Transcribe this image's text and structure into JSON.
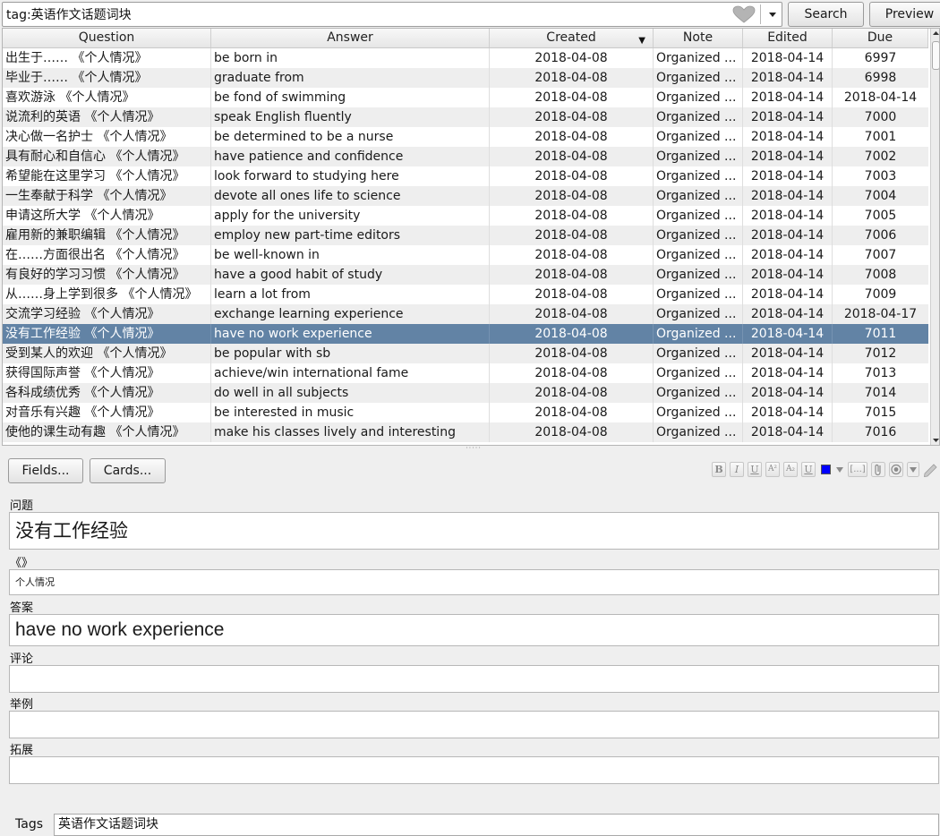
{
  "search": {
    "query": "tag:英语作文话题词块",
    "search_label": "Search",
    "preview_label": "Preview"
  },
  "table": {
    "columns": [
      "Question",
      "Answer",
      "Created",
      "Note",
      "Edited",
      "Due"
    ],
    "sorted_column": "Created",
    "rows": [
      {
        "question": "出生于…… 《个人情况》",
        "answer": "be born in",
        "created": "2018-04-08",
        "note": "Organized ...",
        "edited": "2018-04-14",
        "due": "6997"
      },
      {
        "question": "毕业于…… 《个人情况》",
        "answer": "graduate from",
        "created": "2018-04-08",
        "note": "Organized ...",
        "edited": "2018-04-14",
        "due": "6998"
      },
      {
        "question": "喜欢游泳 《个人情况》",
        "answer": "be fond of swimming",
        "created": "2018-04-08",
        "note": "Organized ...",
        "edited": "2018-04-14",
        "due": "2018-04-14"
      },
      {
        "question": "说流利的英语 《个人情况》",
        "answer": "speak English fluently",
        "created": "2018-04-08",
        "note": "Organized ...",
        "edited": "2018-04-14",
        "due": "7000"
      },
      {
        "question": "决心做一名护士 《个人情况》",
        "answer": "be determined to be a nurse",
        "created": "2018-04-08",
        "note": "Organized ...",
        "edited": "2018-04-14",
        "due": "7001"
      },
      {
        "question": "具有耐心和自信心 《个人情况》",
        "answer": "have patience and confidence",
        "created": "2018-04-08",
        "note": "Organized ...",
        "edited": "2018-04-14",
        "due": "7002"
      },
      {
        "question": "希望能在这里学习 《个人情况》",
        "answer": "look forward to studying here",
        "created": "2018-04-08",
        "note": "Organized ...",
        "edited": "2018-04-14",
        "due": "7003"
      },
      {
        "question": "一生奉献于科学 《个人情况》",
        "answer": "devote all ones life to science",
        "created": "2018-04-08",
        "note": "Organized ...",
        "edited": "2018-04-14",
        "due": "7004"
      },
      {
        "question": "申请这所大学 《个人情况》",
        "answer": "apply for the university",
        "created": "2018-04-08",
        "note": "Organized ...",
        "edited": "2018-04-14",
        "due": "7005"
      },
      {
        "question": "雇用新的兼职编辑 《个人情况》",
        "answer": "employ new part-time editors",
        "created": "2018-04-08",
        "note": "Organized ...",
        "edited": "2018-04-14",
        "due": "7006"
      },
      {
        "question": "在……方面很出名 《个人情况》",
        "answer": "be well-known in",
        "created": "2018-04-08",
        "note": "Organized ...",
        "edited": "2018-04-14",
        "due": "7007"
      },
      {
        "question": "有良好的学习习惯 《个人情况》",
        "answer": "have a good habit of study",
        "created": "2018-04-08",
        "note": "Organized ...",
        "edited": "2018-04-14",
        "due": "7008"
      },
      {
        "question": "从……身上学到很多 《个人情况》",
        "answer": "learn a lot from",
        "created": "2018-04-08",
        "note": "Organized ...",
        "edited": "2018-04-14",
        "due": "7009"
      },
      {
        "question": "交流学习经验 《个人情况》",
        "answer": "exchange learning experience",
        "created": "2018-04-08",
        "note": "Organized ...",
        "edited": "2018-04-14",
        "due": "2018-04-17"
      },
      {
        "question": "没有工作经验 《个人情况》",
        "answer": "have no work experience",
        "created": "2018-04-08",
        "note": "Organized ...",
        "edited": "2018-04-14",
        "due": "7011"
      },
      {
        "question": "受到某人的欢迎 《个人情况》",
        "answer": "be popular with sb",
        "created": "2018-04-08",
        "note": "Organized ...",
        "edited": "2018-04-14",
        "due": "7012"
      },
      {
        "question": "获得国际声誉 《个人情况》",
        "answer": "achieve/win international fame",
        "created": "2018-04-08",
        "note": "Organized ...",
        "edited": "2018-04-14",
        "due": "7013"
      },
      {
        "question": "各科成绩优秀 《个人情况》",
        "answer": "do well in all subjects",
        "created": "2018-04-08",
        "note": "Organized ...",
        "edited": "2018-04-14",
        "due": "7014"
      },
      {
        "question": "对音乐有兴趣 《个人情况》",
        "answer": "be interested in music",
        "created": "2018-04-08",
        "note": "Organized ...",
        "edited": "2018-04-14",
        "due": "7015"
      },
      {
        "question": "使他的课生动有趣 《个人情况》",
        "answer": "make his classes lively and interesting",
        "created": "2018-04-08",
        "note": "Organized ...",
        "edited": "2018-04-14",
        "due": "7016"
      }
    ],
    "selected_row": 14
  },
  "editor": {
    "fields_label": "Fields...",
    "cards_label": "Cards...",
    "fields": [
      {
        "label": "问题",
        "value": "没有工作经验"
      },
      {
        "label": "《》",
        "value": "个人情况"
      },
      {
        "label": "答案",
        "value": "have no work experience"
      },
      {
        "label": "评论",
        "value": ""
      },
      {
        "label": "举例",
        "value": ""
      },
      {
        "label": "拓展",
        "value": ""
      }
    ],
    "tags_label": "Tags",
    "tags_value": "英语作文话题词块"
  },
  "toolbar": {
    "bold": "B",
    "italic": "I",
    "underline": "U",
    "superscript": "A²",
    "subscript": "A₂",
    "clear": "U",
    "cloze": "[...]",
    "text_color": "#0000ff"
  },
  "colors": {
    "selection": "#6283a5",
    "row_alt": "#eeeeee"
  }
}
